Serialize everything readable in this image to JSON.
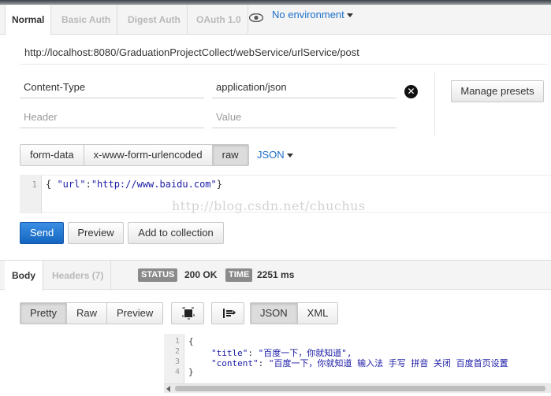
{
  "auth_tabs": [
    "Normal",
    "Basic Auth",
    "Digest Auth",
    "OAuth 1.0"
  ],
  "environment": {
    "label": "No environment"
  },
  "request": {
    "url": "http://localhost:8080/GraduationProjectCollect/webService/urlService/post"
  },
  "headers": {
    "row1": {
      "key": "Content-Type",
      "value": "application/json"
    },
    "row2": {
      "key_placeholder": "Header",
      "value_placeholder": "Value"
    },
    "manage_presets": "Manage presets"
  },
  "body_types": [
    "form-data",
    "x-www-form-urlencoded",
    "raw"
  ],
  "body_format": "JSON",
  "body_editor": {
    "line": "1",
    "open": "{ ",
    "key": "\"url\"",
    "colon": ":",
    "value": "\"http://www.baidu.com\"",
    "close": "}"
  },
  "watermark": "http://blog.csdn.net/chuchus",
  "actions": {
    "send": "Send",
    "preview": "Preview",
    "add": "Add to collection"
  },
  "response_tabs": [
    "Body",
    "Headers (7)"
  ],
  "status": {
    "label": "STATUS",
    "value": "200 OK"
  },
  "time": {
    "label": "TIME",
    "value": "2251 ms"
  },
  "view_modes": [
    "Pretty",
    "Raw",
    "Preview"
  ],
  "formats": [
    "JSON",
    "XML"
  ],
  "response_body": {
    "line_numbers": [
      "1",
      "2",
      "3",
      "4"
    ],
    "open": "{",
    "title_key": "\"title\"",
    "title_value": "\"百度一下，你就知道\",",
    "content_key": "\"content\"",
    "content_value": "\"百度一下，你就知道 输入法 手写 拼音 关闭 百度首页设置",
    "close": "}"
  },
  "colors": {
    "accent": "#1a6fc9",
    "send_button": "#1565c0",
    "badge": "#8a8a8a"
  }
}
